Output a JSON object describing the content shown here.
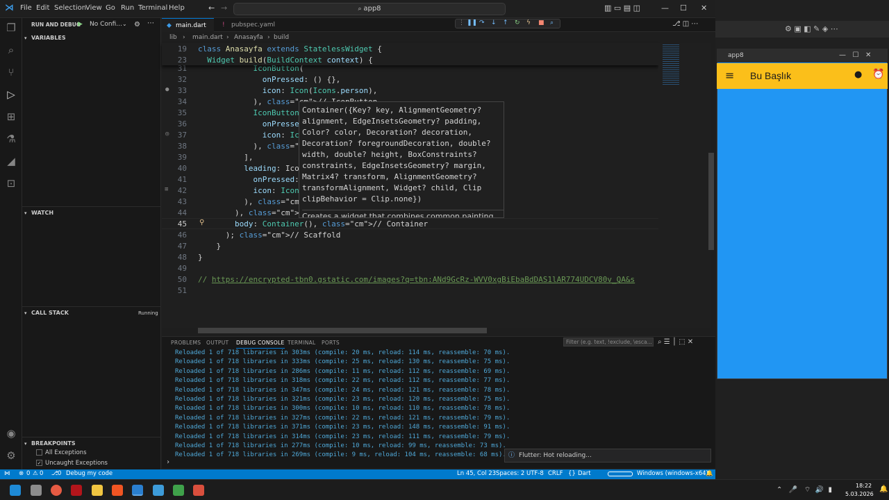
{
  "titlebar": {
    "menu": [
      "File",
      "Edit",
      "Selection",
      "View",
      "Go",
      "Run",
      "Terminal",
      "Help"
    ],
    "search": "app8"
  },
  "sidebar": {
    "run_title": "RUN AND DEBUG",
    "config": "No Confi...",
    "variables": "VARIABLES",
    "watch": "WATCH",
    "callstack": "CALL STACK",
    "callstack_status": "Running",
    "breakpoints": "BREAKPOINTS",
    "bp_items": [
      "All Exceptions",
      "Uncaught Exceptions"
    ]
  },
  "tabs": [
    {
      "label": "main.dart",
      "active": true
    },
    {
      "label": "pubspec.yaml",
      "active": false
    }
  ],
  "breadcrumb": [
    "lib",
    "main.dart",
    "Anasayfa",
    "build"
  ],
  "sticky_lines": [
    {
      "n": "19",
      "text": "class Anasayfa extends StatelessWidget {"
    },
    {
      "n": "23",
      "text": "  Widget build(BuildContext context) {"
    }
  ],
  "code_lines": [
    {
      "n": "31",
      "text": "            IconButton("
    },
    {
      "n": "32",
      "text": "              onPressed: () {},"
    },
    {
      "n": "33",
      "text": "              icon: Icon(Icons.person),"
    },
    {
      "n": "34",
      "text": "            ), // IconButton"
    },
    {
      "n": "35",
      "text": "            IconButton("
    },
    {
      "n": "36",
      "text": "              onPressed:"
    },
    {
      "n": "37",
      "text": "              icon: Icon"
    },
    {
      "n": "38",
      "text": "            ), // IconBu"
    },
    {
      "n": "39",
      "text": "          ],"
    },
    {
      "n": "40",
      "text": "          leading: IconB"
    },
    {
      "n": "41",
      "text": "            onPressed: ("
    },
    {
      "n": "42",
      "text": "            icon: Icon(I"
    },
    {
      "n": "43",
      "text": "          ), // IconButt"
    },
    {
      "n": "44",
      "text": "        ), // AppBar"
    },
    {
      "n": "45",
      "text": "        body: Container(), // Container"
    },
    {
      "n": "46",
      "text": "      ); // Scaffold"
    },
    {
      "n": "47",
      "text": "    }"
    },
    {
      "n": "48",
      "text": "}"
    },
    {
      "n": "49",
      "text": ""
    },
    {
      "n": "50",
      "text": "// https://encrypted-tbn0.gstatic.com/images?q=tbn:ANd9GcRz-WVV0xgBiEbaBdDAS1lAR774UDCV80v_QA&s"
    },
    {
      "n": "51",
      "text": ""
    }
  ],
  "hover": {
    "signature": "Container({Key? key, AlignmentGeometry? alignment, EdgeInsetsGeometry? padding, Color? color, Decoration? decoration, Decoration? foregroundDecoration, double? width, double? height, BoxConstraints? constraints, EdgeInsetsGeometry? margin, Matrix4? transform, AlignmentGeometry? transformAlignment, Widget? child, Clip clipBehavior = Clip.none})",
    "doc": "Creates a widget that combines common painting,"
  },
  "panel": {
    "tabs": [
      "PROBLEMS",
      "OUTPUT",
      "DEBUG CONSOLE",
      "TERMINAL",
      "PORTS"
    ],
    "filter_placeholder": "Filter (e.g. text, !exclude, \\esca...",
    "lines": [
      "Reloaded 1 of 718 libraries in 303ms (compile: 20 ms, reload: 114 ms, reassemble: 70 ms).",
      "Reloaded 1 of 718 libraries in 333ms (compile: 25 ms, reload: 130 ms, reassemble: 75 ms).",
      "Reloaded 1 of 718 libraries in 286ms (compile: 11 ms, reload: 112 ms, reassemble: 69 ms).",
      "Reloaded 1 of 718 libraries in 318ms (compile: 22 ms, reload: 112 ms, reassemble: 77 ms).",
      "Reloaded 1 of 718 libraries in 347ms (compile: 24 ms, reload: 121 ms, reassemble: 78 ms).",
      "Reloaded 1 of 718 libraries in 321ms (compile: 23 ms, reload: 120 ms, reassemble: 75 ms).",
      "Reloaded 1 of 718 libraries in 300ms (compile: 10 ms, reload: 110 ms, reassemble: 78 ms).",
      "Reloaded 1 of 718 libraries in 327ms (compile: 22 ms, reload: 121 ms, reassemble: 79 ms).",
      "Reloaded 1 of 718 libraries in 371ms (compile: 23 ms, reload: 148 ms, reassemble: 91 ms).",
      "Reloaded 1 of 718 libraries in 314ms (compile: 23 ms, reload: 111 ms, reassemble: 79 ms).",
      "Reloaded 1 of 718 libraries in 277ms (compile: 10 ms, reload: 99 ms, reassemble: 73 ms).",
      "Reloaded 1 of 718 libraries in 269ms (compile: 9 ms, reload: 104 ms, reassemble: 68 ms)."
    ],
    "toast": "Flutter: Hot reloading..."
  },
  "statusbar": {
    "errors": "0",
    "warnings": "0",
    "ports": "0",
    "debug": "Debug my code",
    "position": "Ln 45, Col 23",
    "spaces": "Spaces: 2",
    "encoding": "UTF-8",
    "eol": "CRLF",
    "language": "Dart",
    "device": "Windows (windows-x64)"
  },
  "app": {
    "window_title": "app8",
    "appbar_title": "Bu Başlık"
  },
  "taskbar": {
    "time": "18:22",
    "date": "5.03.2026"
  },
  "colors": {
    "accent": "#007acc",
    "appbar": "#fbbf1a",
    "app_body": "#2196f3"
  }
}
